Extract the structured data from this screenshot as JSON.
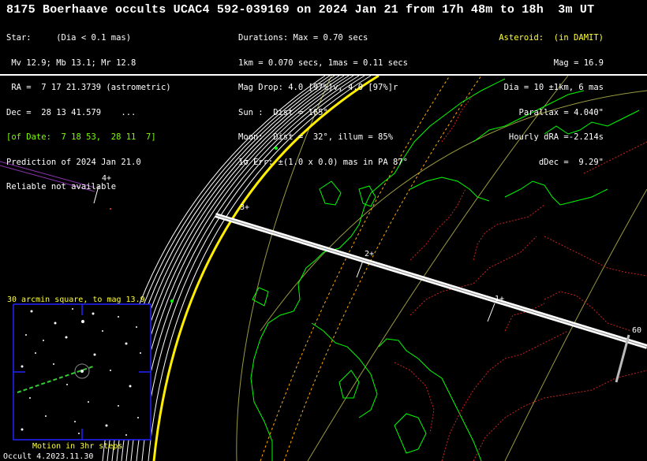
{
  "header": {
    "title": "8175 Boerhaave occults UCAC4 592-039169 on 2024 Jan 21 from 17h 48m to 18h  3m UT",
    "col1": [
      "Star:     (Dia < 0.1 mas)",
      " Mv 12.9; Mb 13.1; Mr 12.8",
      " RA =  7 17 21.3739 (astrometric)",
      "Dec =  28 13 41.579    ...",
      "[of Date:  7 18 53,  28 11  7]",
      "Prediction of 2024 Jan 21.0",
      "Reliable not available"
    ],
    "col2": [
      "Durations: Max = 0.70 secs",
      "1km = 0.070 secs, 1mas = 0.11 secs",
      "Mag Drop: 4.0 [97%]v, 4.0 [97%]r",
      "Sun :  Dist = 165°",
      "Moon:  Dist =  32°, illum = 85%",
      "1σ Err: ±(1.0 x 0.0) mas in PA 87°"
    ],
    "col3_title": "Asteroid:  (in DAMIT)",
    "col3": [
      "Mag = 16.9",
      "Dia = 10 ±1km, 6 mas",
      "Parallax = 4.040\"",
      "Hourly dRA =-2.214s",
      "dDec =  9.29\""
    ]
  },
  "map": {
    "time_markers": [
      "4+",
      "3+",
      "2+",
      "1+"
    ],
    "edge_label": "60",
    "colors": {
      "coast": "#00ff00",
      "borders": "#cc2222",
      "path": "#ffffff",
      "error_lines": "#ffaa00",
      "terminator": "#ffff00",
      "grid": "#9a9a40"
    }
  },
  "finder": {
    "title": "30 arcmin square, to mag 13.9",
    "caption": "Motion in 3hr steps",
    "frame_color": "#2222ff",
    "path_color": "#33cc33"
  },
  "footer": {
    "version": "Occult 4.2023.11.30"
  }
}
